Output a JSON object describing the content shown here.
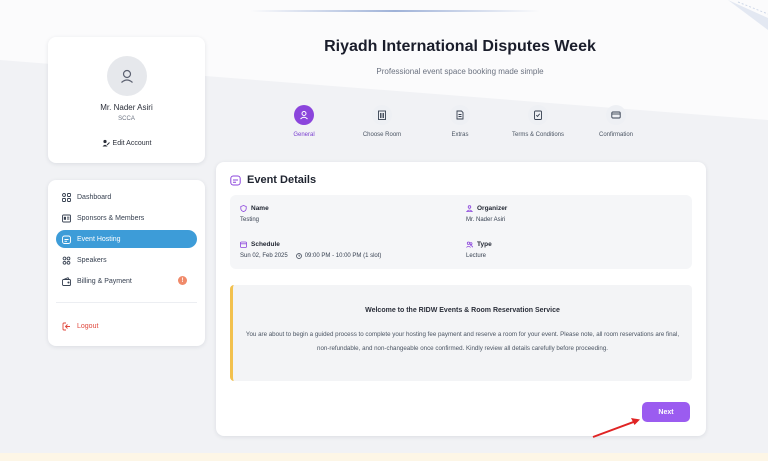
{
  "profile": {
    "name": "Mr. Nader Asiri",
    "org": "SCCA",
    "edit_label": "Edit Account"
  },
  "nav": {
    "items": [
      {
        "label": "Dashboard",
        "icon": "grid-icon"
      },
      {
        "label": "Sponsors & Members",
        "icon": "id-card-icon"
      },
      {
        "label": "Event Hosting",
        "icon": "calendar-icon",
        "active": true
      },
      {
        "label": "Speakers",
        "icon": "users-icon"
      },
      {
        "label": "Billing & Payment",
        "icon": "wallet-icon",
        "badge": "!"
      }
    ],
    "logout_label": "Logout"
  },
  "header": {
    "title": "Riyadh International Disputes Week",
    "subtitle": "Professional event space booking made simple"
  },
  "steps": [
    {
      "label": "General",
      "icon": "user-icon",
      "active": true
    },
    {
      "label": "Choose Room",
      "icon": "building-icon"
    },
    {
      "label": "Extras",
      "icon": "document-icon"
    },
    {
      "label": "Terms & Conditions",
      "icon": "checklist-icon"
    },
    {
      "label": "Confirmation",
      "icon": "card-icon"
    }
  ],
  "event": {
    "section_title": "Event Details",
    "name_label": "Name",
    "name_value": "Testing",
    "organizer_label": "Organizer",
    "organizer_value": "Mr. Nader Asiri",
    "schedule_label": "Schedule",
    "schedule_date": "Sun 02, Feb 2025",
    "schedule_time": "09:00 PM - 10:00 PM (1 slot)",
    "type_label": "Type",
    "type_value": "Lecture"
  },
  "welcome": {
    "title": "Welcome to the RIDW Events & Room Reservation Service",
    "body": "You are about to begin a guided process to complete your hosting fee payment and reserve a room for your event. Please note, all room reservations are final, non-refundable, and non-changeable once confirmed. Kindly review all details carefully before proceeding."
  },
  "actions": {
    "next_label": "Next"
  },
  "colors": {
    "accent": "#8b45dc",
    "button": "#9b5cf0",
    "nav_active": "#3d9cd8",
    "warning_border": "#f2c14e",
    "logout": "#e0473c",
    "arrow": "#e02424"
  }
}
